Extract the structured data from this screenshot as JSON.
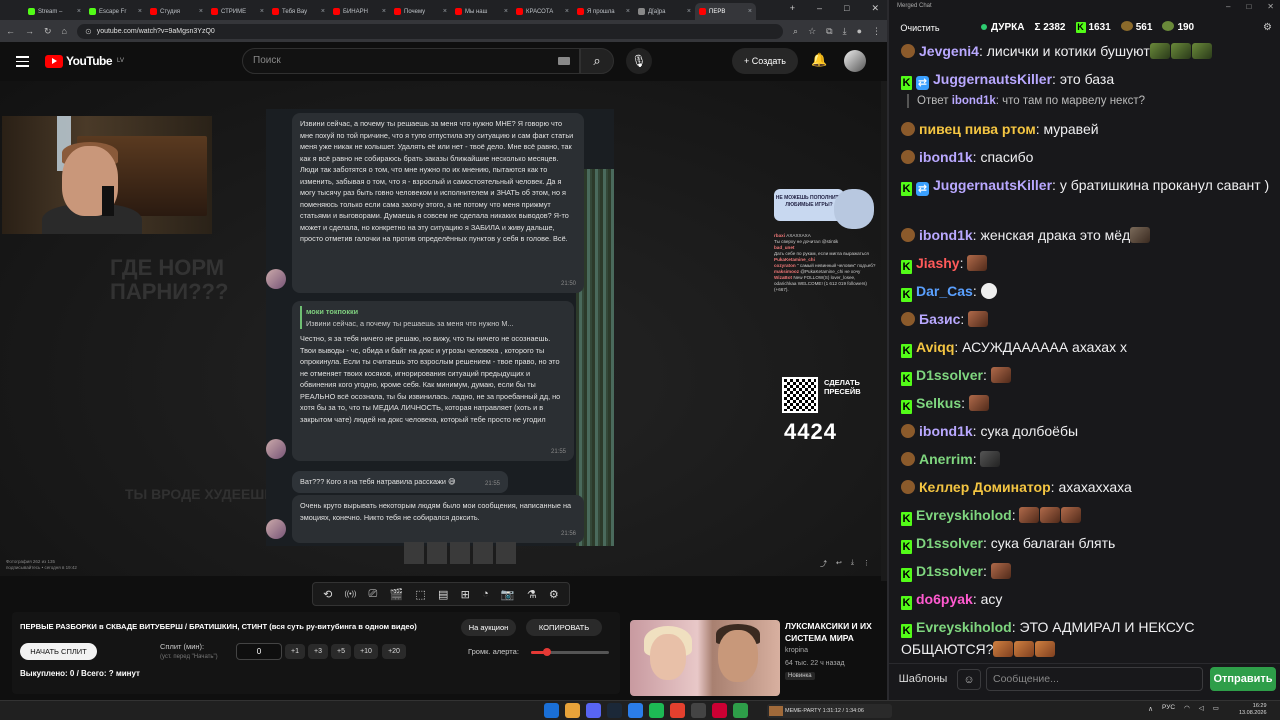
{
  "browser": {
    "tabs": [
      {
        "label": "Stream –",
        "color": "#53fc18",
        "active": false
      },
      {
        "label": "Escape Fr",
        "color": "#53fc18",
        "active": false
      },
      {
        "label": "Студия",
        "color": "#ff0000",
        "active": false
      },
      {
        "label": "СТРИМЕ",
        "color": "#ff0000",
        "active": false
      },
      {
        "label": "Тебя Вау",
        "color": "#ff0000",
        "active": false
      },
      {
        "label": "БИНАРН",
        "color": "#ff0000",
        "active": false
      },
      {
        "label": "Почему",
        "color": "#ff0000",
        "active": false
      },
      {
        "label": "Мы наш",
        "color": "#ff0000",
        "active": false
      },
      {
        "label": "КРАСОТА",
        "color": "#ff0000",
        "active": false
      },
      {
        "label": "Я прошла",
        "color": "#ff0000",
        "active": false
      },
      {
        "label": "Д[а]ра",
        "color": "#888888",
        "active": false
      },
      {
        "label": "ПЕРВ",
        "color": "#ff0000",
        "active": true
      }
    ],
    "url": "youtube.com/watch?v=9aMgsn3YzQ0"
  },
  "youtube": {
    "logo": "YouTube",
    "region": "LV",
    "search_placeholder": "Поиск",
    "create_label": "Создать"
  },
  "stream": {
    "chat_bubbles": [
      {
        "text": "Извини сейчас, а почему ты решаешь за меня что нужно МНЕ? Я говорю что мне похуй по той причине, что я тупо отпустила эту ситуацию и сам факт статьи меня уже никак не колышет. Удалять её или нет - твоё дело. Мне всё равно, так как я всё равно не собираюсь брать заказы ближайшие несколько месяцев. Люди так заботятся о том, что мне нужно по их мнению, пытаются как то изменить, забывая о том, что я - взрослый и самостоятельный человек. Да я могу тысячу раз быть говно человеком и исполнителем и ЗНАТЬ об этом, но я поменяюсь только если сама захочу этого, а не потому что меня прижмут статьями и выговорами. Думаешь я совсем не сделала никаких выводов? Я-то может и сделала, но конкретно на эту ситуацию я ЗАБИЛА и живу дальше, просто отметив галочки на против определённых пунктов у себя в голове. Всё.",
        "time": "21:50"
      },
      {
        "quote_name": "моки токпокки",
        "quote_text": "Извини сейчас, а почему ты решаешь за меня что нужно М...",
        "text": "Честно, я за тебя ничего не решаю, но вижу, что ты ничего не осознаешь. Твои выводы - чс, обида и байт на докс и угрозы человека , которого ты опрокинула. Если ты считаешь это взрослым решением - твое право, но это не отменяет твоих косяков, игнорирования ситуаций предыдущих и обвинения кого угодно, кроме себя. Как минимум, думаю, если бы ты РЕАЛЬНО всё осознала, ты бы извинилась. ладно, не за проебанный дд, но хотя бы за то, что ты МЕДИА ЛИЧНОСТЬ, которая натравляет (хоть и в закрытом чате) людей на докс человека, который тебе просто не угодил",
        "time": "21:55"
      },
      {
        "text": "Ват??? Кого я на тебя натравила расскажи 😅",
        "time": "21:55"
      },
      {
        "text": "Очень круто вырывать некоторым людям было мои сообщения, написанные на эмоциях, конечно. Никто тебя не собирался доксить.",
        "time": "21:56"
      }
    ],
    "ghost_text": "ГДЕ НОРМ\nПАРНИ???",
    "ghost_text2": "ТЫ ВРОДЕ ХУДЕЕШЬ",
    "overlay_banner": "НЕ МОЖЕШЬ ПОПОЛНИТЬ ЛЮБИМЫЕ ИГРЫ?",
    "overlay_chat": [
      {
        "nick": "rbaxi",
        "text": "АХАХХАХА"
      },
      {
        "nick": "",
        "text": "Ты сверху не дочитал @stintik"
      },
      {
        "nick": "bad_unet",
        "text": ""
      },
      {
        "nick": "",
        "text": "Дать себе по рукам, если мигла выражаться"
      },
      {
        "nick": "PukaKetamine_chi",
        "text": ""
      },
      {
        "nick": "cozyraton",
        "text": "\" самый невинный человек\" подъеб?"
      },
      {
        "nick": "maksimooz",
        "text": "@PukaKetamine_chi не хочу"
      },
      {
        "nick": "WizaBot",
        "text": "New FOLLOW(S) lover_losee, odarichkaa WELCOME! (1 612 019 followers) (+667)."
      }
    ],
    "qr_label": "СДЕЛАТЬ ПРЕСЕЙВ",
    "counter": "4424",
    "caption": "Фотография 262 из 135\nподписывайтесь • сегодня в 19:42"
  },
  "controls": {
    "icons": [
      "repeat-icon",
      "broadcast-icon",
      "cast-icon",
      "clapper-icon",
      "crop-icon",
      "film-icon",
      "plus-box-icon",
      "gauge-icon",
      "camera-icon",
      "flask-icon",
      "gear-icon"
    ]
  },
  "panel": {
    "title": "ПЕРВЫЕ РАЗБОРКИ в СКВАДЕ ВИТУБЕРШ / БРАТИШКИН, СТИНТ (вся суть ру-витубинга в одном видео)",
    "auction_label": "На аукцион",
    "copy_label": "КОПИРОВАТЬ",
    "split_button": "НАЧАТЬ СПЛИТ",
    "split_label": "Сплит (мин):",
    "split_sub": "(уст. перед \"Начать\")",
    "split_value": "0",
    "increments": [
      "+1",
      "+3",
      "+5",
      "+10",
      "+20"
    ],
    "volume_label": "Громк. алерта:",
    "volume": 0.2,
    "bought": "Выкуплено: 0 / Всего: ? минут"
  },
  "recommendation": {
    "title": "ЛУКСМАКСИКИ И ИХ СИСТЕМА МИРА",
    "channel": "kropina",
    "meta": "64 тыс.  22 ч назад",
    "badge": "Новинка"
  },
  "chat": {
    "window_title": "Merged Chat",
    "clear_label": "Очистить",
    "channel": "ДУРКА",
    "total": "Σ 2382",
    "kick_count": "1631",
    "twitch_count": "561",
    "other_count": "190",
    "messages": [
      {
        "platform": "twitch",
        "nick": "Jevgeni4",
        "color": "#b9a8ff",
        "text": "лисички и котики бушуют",
        "emotes": [
          "pepe",
          "pepe",
          "pepe"
        ]
      },
      {
        "platform": "kick",
        "ping": true,
        "nick": "JuggernautsKiller",
        "color": "#b9a8ff",
        "text": "это база"
      },
      {
        "reply": true,
        "reply_prefix": "Ответ",
        "reply_nick": "ibond1k",
        "text": "что там по марвелу некст?"
      },
      {
        "platform": "twitch",
        "nick": "пивец пива ртом",
        "color": "#f4c542",
        "text": "муравей"
      },
      {
        "platform": "twitch",
        "nick": "ibond1k",
        "color": "#b9a8ff",
        "text": "спасибо"
      },
      {
        "platform": "kick",
        "ping": true,
        "nick": "JuggernautsKiller",
        "color": "#b9a8ff",
        "text": "у братишкина проканул савант )"
      },
      {
        "platform": "twitch",
        "nick": "ibond1k",
        "color": "#b9a8ff",
        "text": "женская драка это мёд",
        "emotes": [
          "pot"
        ]
      },
      {
        "platform": "kick",
        "nick": "Jiashy",
        "color": "#ff5a5a",
        "text": "",
        "emotes": [
          "face"
        ]
      },
      {
        "platform": "kick",
        "nick": "Dar_Cas",
        "color": "#5aa0ff",
        "text": "",
        "emotes": [
          "mask"
        ]
      },
      {
        "platform": "twitch",
        "nick": "Базис",
        "color": "#b9a8ff",
        "text": "",
        "emotes": [
          "face"
        ]
      },
      {
        "platform": "kick",
        "nick": "Aviqq",
        "color": "#f4c542",
        "text": "АСУЖДАААААА ахахах х"
      },
      {
        "platform": "kick",
        "nick": "D1ssolver",
        "color": "#7fd67f",
        "text": "",
        "emotes": [
          "face"
        ]
      },
      {
        "platform": "kick",
        "nick": "Selkus",
        "color": "#7fd67f",
        "text": "",
        "emotes": [
          "face"
        ]
      },
      {
        "platform": "twitch",
        "nick": "ibond1k",
        "color": "#b9a8ff",
        "text": "сука долбоёбы"
      },
      {
        "platform": "twitch",
        "nick": "Anerrim",
        "color": "#7fd67f",
        "text": "",
        "emotes": [
          "dark"
        ]
      },
      {
        "platform": "twitch",
        "nick": "Келлер Доминатор",
        "color": "#f4c542",
        "text": "ахахаххаха"
      },
      {
        "platform": "kick",
        "nick": "Evreyskiholod",
        "color": "#7fd67f",
        "text": "",
        "emotes": [
          "face",
          "face",
          "face"
        ]
      },
      {
        "platform": "kick",
        "nick": "D1ssolver",
        "color": "#7fd67f",
        "text": "сука балаган блять"
      },
      {
        "platform": "kick",
        "nick": "D1ssolver",
        "color": "#7fd67f",
        "text": "",
        "emotes": [
          "face"
        ]
      },
      {
        "platform": "kick",
        "nick": "do6pyak",
        "color": "#ff5ad0",
        "text": "асу"
      },
      {
        "platform": "kick",
        "nick": "Evreyskiholod",
        "color": "#7fd67f",
        "text": "ЭТО АДМИРАЛ И НЕКСУС ОБЩАЮТСЯ?",
        "emotes": [
          "cat",
          "cat",
          "cat"
        ]
      }
    ],
    "templates_label": "Шаблоны",
    "input_placeholder": "Сообщение...",
    "send_label": "Отправить"
  },
  "taskbar": {
    "media": "MEME-PARTY  1:31:12 / 1:34:06",
    "lang": "РУС",
    "time": "16:29",
    "date": "13.08.2026"
  }
}
